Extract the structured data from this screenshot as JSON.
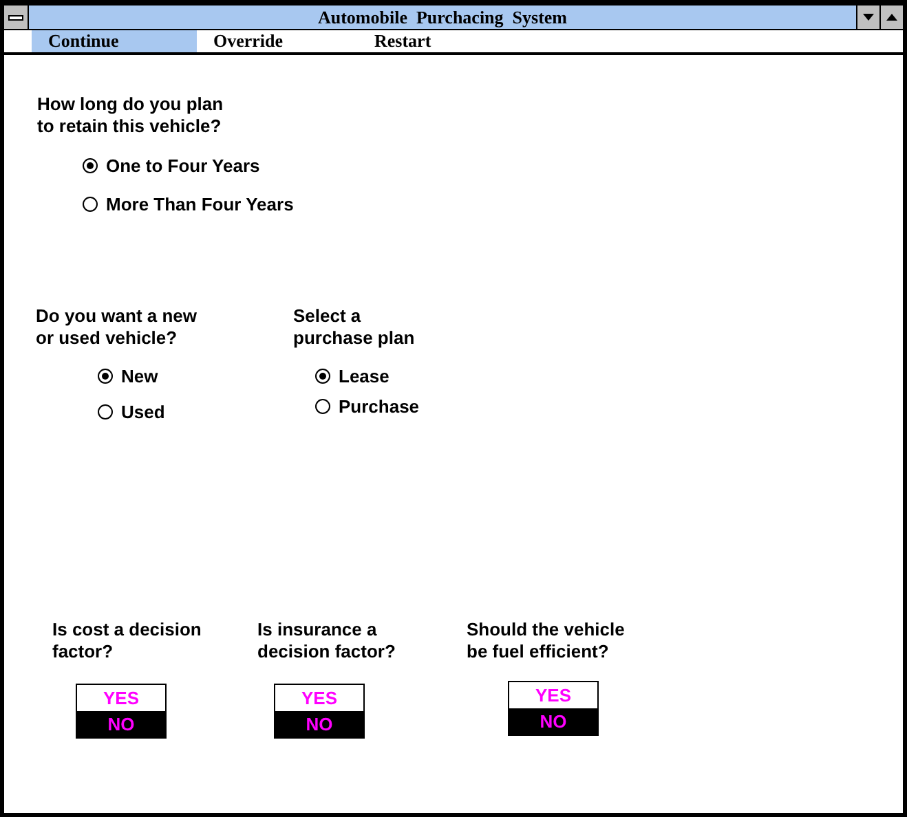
{
  "window": {
    "title": "Automobile  Purchacing  System"
  },
  "menu": [
    {
      "label": "Continue",
      "selected": true
    },
    {
      "label": "Override",
      "selected": false
    },
    {
      "label": "Restart",
      "selected": false
    }
  ],
  "retention": {
    "question": "How long do you plan\nto retain this vehicle?",
    "options": [
      {
        "label": "One to Four Years",
        "selected": true
      },
      {
        "label": "More Than Four Years",
        "selected": false
      }
    ]
  },
  "vehicle_type": {
    "question": "Do you want a new\nor used vehicle?",
    "options": [
      {
        "label": "New",
        "selected": true
      },
      {
        "label": "Used",
        "selected": false
      }
    ]
  },
  "purchase_plan": {
    "question": "Select a\npurchase plan",
    "options": [
      {
        "label": "Lease",
        "selected": true
      },
      {
        "label": "Purchase",
        "selected": false
      }
    ]
  },
  "factors": [
    {
      "question": "Is cost a decision\nfactor?",
      "options": [
        {
          "label": "YES",
          "selected": false
        },
        {
          "label": "NO",
          "selected": true
        }
      ]
    },
    {
      "question": "Is insurance a\ndecision factor?",
      "options": [
        {
          "label": "YES",
          "selected": false
        },
        {
          "label": "NO",
          "selected": true
        }
      ]
    },
    {
      "question": "Should the vehicle\nbe fuel efficient?",
      "options": [
        {
          "label": "YES",
          "selected": false
        },
        {
          "label": "NO",
          "selected": true
        }
      ]
    }
  ]
}
